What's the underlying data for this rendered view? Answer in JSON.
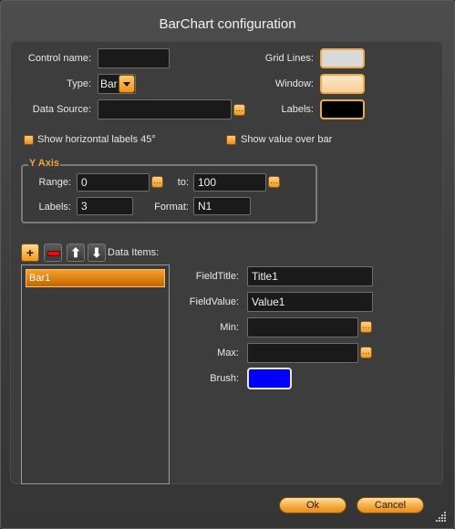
{
  "window": {
    "title": "BarChart configuration"
  },
  "form": {
    "control_name_label": "Control name:",
    "control_name_value": "",
    "type_label": "Type:",
    "type_value": "Bar",
    "data_source_label": "Data Source:",
    "data_source_value": "",
    "grid_lines_label": "Grid Lines:",
    "grid_lines_color": "#d9d9d9",
    "window_label": "Window:",
    "window_color": "#f7cf9a",
    "labels_label": "Labels:",
    "labels_color": "#000000",
    "show_horizontal_label": "Show horizontal labels 45°",
    "show_horizontal_checked": true,
    "show_value_label": "Show value over bar",
    "show_value_checked": true
  },
  "y_axis": {
    "title": "Y Axis",
    "range_label": "Range:",
    "range_from": "0",
    "to_label": "to:",
    "range_to": "100",
    "labels_label": "Labels:",
    "labels_value": "3",
    "format_label": "Format:",
    "format_value": "N1"
  },
  "data_items": {
    "title": "Data Items:",
    "items": [
      "Bar1"
    ],
    "selected_index": 0
  },
  "item": {
    "field_title_label": "FieldTitle:",
    "field_title_value": "Title1",
    "field_value_label": "FieldValue:",
    "field_value_value": "Value1",
    "min_label": "Min:",
    "min_value": "",
    "max_label": "Max:",
    "max_value": "",
    "brush_label": "Brush:",
    "brush_color": "#0000ff"
  },
  "buttons": {
    "ok": "Ok",
    "cancel": "Cancel"
  },
  "accent_color": "#f09a1c"
}
